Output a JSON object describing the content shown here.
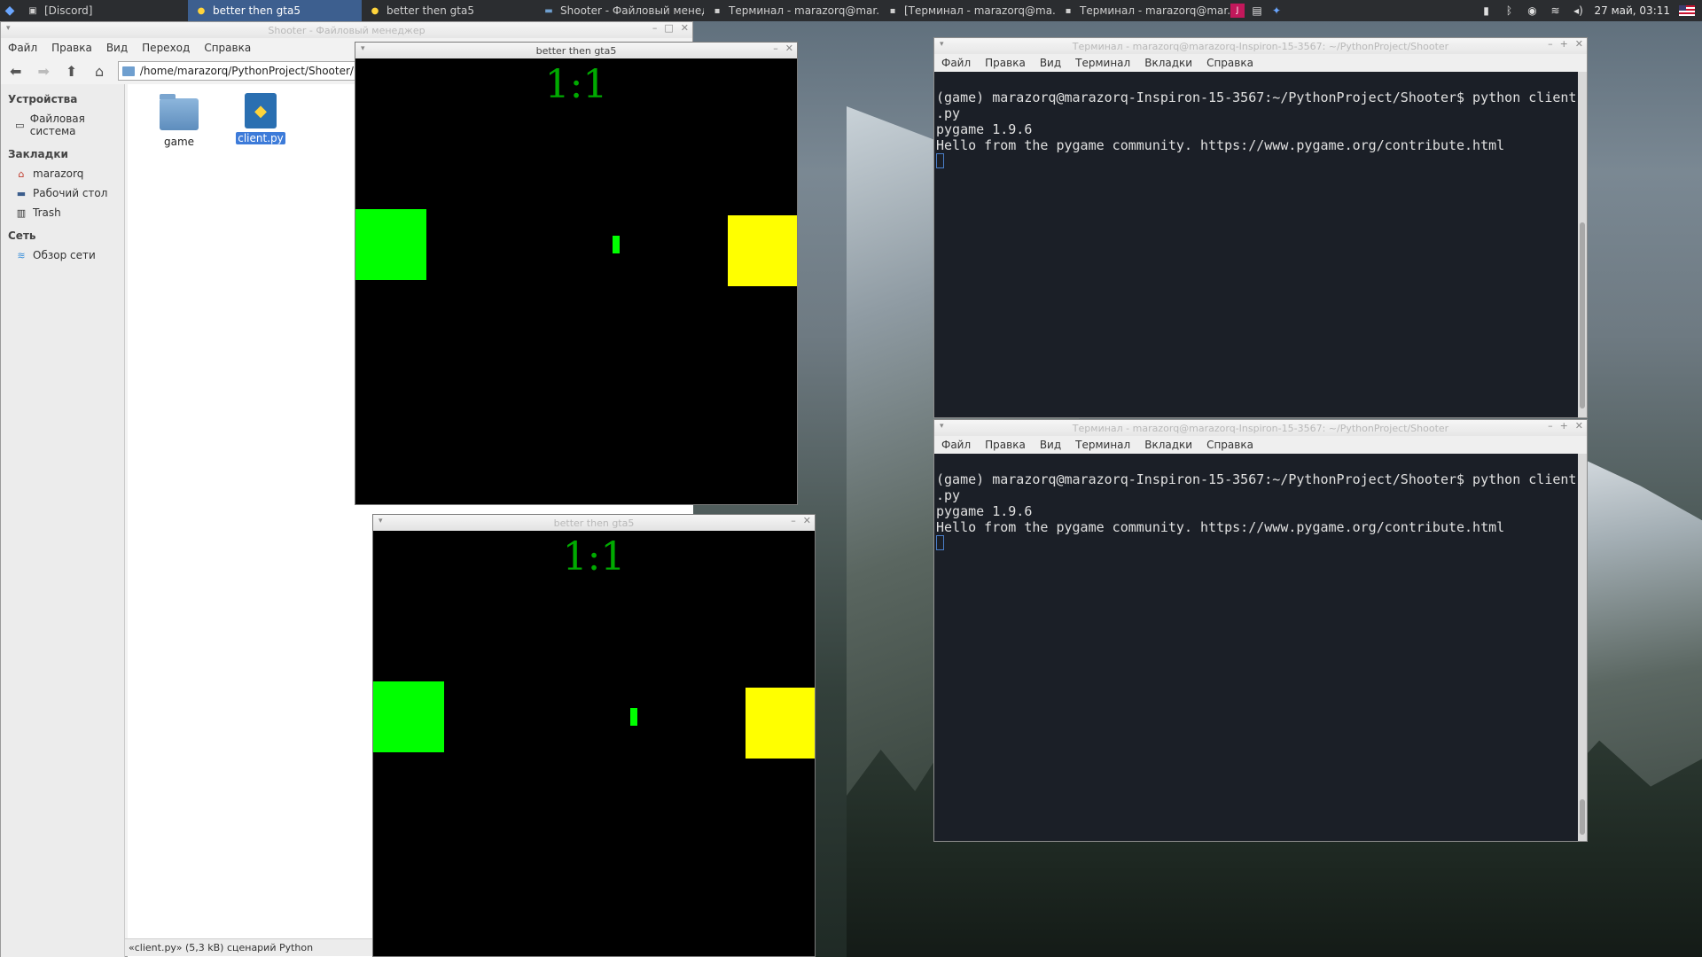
{
  "panel": {
    "tasks": [
      {
        "label": "[Discord]",
        "icon": "discord-icon",
        "active": false
      },
      {
        "label": "better then gta5",
        "icon": "python-icon",
        "active": true
      },
      {
        "label": "better then gta5",
        "icon": "python-icon",
        "active": false
      },
      {
        "label": "Shooter - Файловый менед...",
        "icon": "folder-icon",
        "active": false
      },
      {
        "label": "Терминал - marazorq@mar...",
        "icon": "terminal-icon",
        "active": false
      },
      {
        "label": "[Терминал - marazorq@ma...",
        "icon": "terminal-icon",
        "active": false
      },
      {
        "label": "Терминал - marazorq@mar...",
        "icon": "terminal-icon",
        "active": false
      }
    ],
    "clock": "27 май, 03:11"
  },
  "file_manager": {
    "title": "Shooter - Файловый менеджер",
    "menu": [
      "Файл",
      "Правка",
      "Вид",
      "Переход",
      "Справка"
    ],
    "path": "/home/marazorq/PythonProject/Shooter/",
    "sidebar": {
      "devices_heading": "Устройства",
      "devices": [
        {
          "label": "Файловая система",
          "icon": "drive-icon"
        }
      ],
      "bookmarks_heading": "Закладки",
      "bookmarks": [
        {
          "label": "marazorq",
          "icon": "home-icon"
        },
        {
          "label": "Рабочий стол",
          "icon": "desktop-icon"
        },
        {
          "label": "Trash",
          "icon": "trash-icon"
        }
      ],
      "network_heading": "Сеть",
      "network": [
        {
          "label": "Обзор сети",
          "icon": "network-icon"
        }
      ]
    },
    "files": [
      {
        "name": "game",
        "type": "folder",
        "selected": false
      },
      {
        "name": "client.py",
        "type": "python",
        "selected": true
      }
    ],
    "status": "«client.py» (5,3 kB) сценарий Python"
  },
  "game_windows": [
    {
      "title": "better then gta5",
      "score": "1:1",
      "active": true
    },
    {
      "title": "better then gta5",
      "score": "1:1",
      "active": false
    }
  ],
  "terminals": [
    {
      "title": "Терминал - marazorq@marazorq-Inspiron-15-3567: ~/PythonProject/Shooter",
      "menu": [
        "Файл",
        "Правка",
        "Вид",
        "Терминал",
        "Вкладки",
        "Справка"
      ],
      "lines": [
        "(game) marazorq@marazorq-Inspiron-15-3567:~/PythonProject/Shooter$ python client",
        ".py",
        "pygame 1.9.6",
        "Hello from the pygame community. https://www.pygame.org/contribute.html"
      ]
    },
    {
      "title": "Терминал - marazorq@marazorq-Inspiron-15-3567: ~/PythonProject/Shooter",
      "menu": [
        "Файл",
        "Правка",
        "Вид",
        "Терминал",
        "Вкладки",
        "Справка"
      ],
      "lines": [
        "(game) marazorq@marazorq-Inspiron-15-3567:~/PythonProject/Shooter$ python client",
        ".py",
        "pygame 1.9.6",
        "Hello from the pygame community. https://www.pygame.org/contribute.html"
      ]
    }
  ],
  "colors": {
    "player": "#00ff00",
    "enemy": "#ffff00",
    "score": "#00aa00",
    "taskbar_active": "#3d5f8f"
  }
}
